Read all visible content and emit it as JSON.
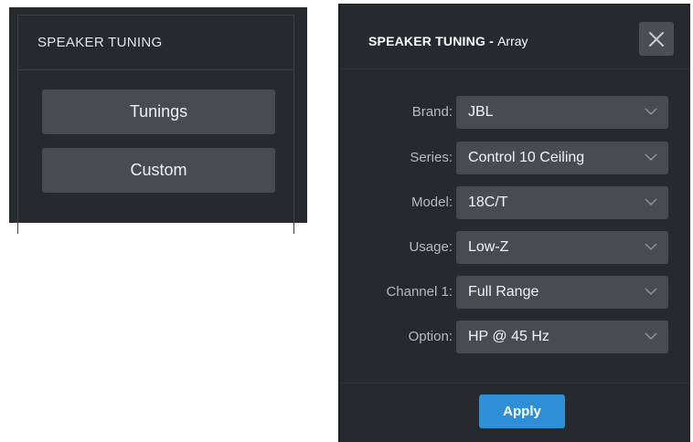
{
  "left_panel": {
    "title": "SPEAKER TUNING",
    "buttons": [
      "Tunings",
      "Custom"
    ]
  },
  "dialog": {
    "title_main": "SPEAKER TUNING - ",
    "title_sub": "Array",
    "close_icon": "close-icon",
    "fields": [
      {
        "label": "Brand:",
        "value": "JBL"
      },
      {
        "label": "Series:",
        "value": "Control 10 Ceiling"
      },
      {
        "label": "Model:",
        "value": "18C/T"
      },
      {
        "label": "Usage:",
        "value": "Low-Z"
      },
      {
        "label": "Channel 1:",
        "value": "Full Range"
      },
      {
        "label": "Option:",
        "value": "HP @ 45 Hz"
      }
    ],
    "apply_label": "Apply"
  },
  "colors": {
    "panel_bg": "#262a2e",
    "control_bg": "#474c52",
    "accent": "#2f8fd6"
  }
}
